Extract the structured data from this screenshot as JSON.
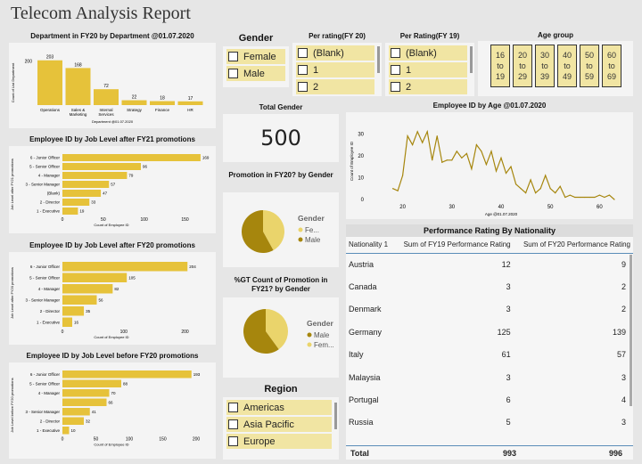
{
  "report_title": "Telecom Analysis Report",
  "colors": {
    "bar": "#e6c23a",
    "dark": "#a6860d",
    "light": "#ead46b",
    "slicer": "#f1e5a3"
  },
  "dept": {
    "title": "Department in FY20 by Department @01.07.2020",
    "ylabel": "Count of List Department",
    "xlabel": "Department @01.07.2020",
    "ytick": "200",
    "bars": [
      {
        "label": "Operations",
        "value": 203
      },
      {
        "label": "Sales & Marketing",
        "value": 168
      },
      {
        "label": "Internal Services",
        "value": 72
      },
      {
        "label": "Strategy",
        "value": 22
      },
      {
        "label": "Finance",
        "value": 18
      },
      {
        "label": "HR",
        "value": 17
      }
    ]
  },
  "job_fy21": {
    "title": "Employee ID by Job Level after FY21 promotions",
    "ylabel": "Job Level after FY21 promotions",
    "xticks": [
      "0",
      "50",
      "100",
      "150"
    ],
    "xlabel": "Count of Employee ID",
    "bars": [
      {
        "label": "6 - Junior Officer",
        "value": 169
      },
      {
        "label": "5 - Senior Officer",
        "value": 96
      },
      {
        "label": "4 - Manager",
        "value": 79
      },
      {
        "label": "3 - Senior Manager",
        "value": 57
      },
      {
        "label": "(Blank)",
        "value": 47
      },
      {
        "label": "2 - Director",
        "value": 33
      },
      {
        "label": "1 - Executive",
        "value": 19
      }
    ]
  },
  "job_fy20": {
    "title": "Employee ID by Job Level after FY20 promotions",
    "ylabel": "Job Level after FY20 promotions",
    "xticks": [
      "0",
      "100",
      "200"
    ],
    "xlabel": "Count of Employee ID",
    "bars": [
      {
        "label": "6 - Junior Officer",
        "value": 204
      },
      {
        "label": "5 - Senior Officer",
        "value": 105
      },
      {
        "label": "4 - Manager",
        "value": 82
      },
      {
        "label": "3 - Senior Manager",
        "value": 56
      },
      {
        "label": "2 - Director",
        "value": 35
      },
      {
        "label": "1 - Executive",
        "value": 16
      }
    ]
  },
  "job_before": {
    "title": "Employee ID by Job Level before FY20 promotions",
    "ylabel": "Job Level before FY20 promotions",
    "xticks": [
      "0",
      "50",
      "100",
      "150",
      "200"
    ],
    "xlabel": "Count of Employee ID",
    "bars": [
      {
        "label": "6 - Junior Officer",
        "value": 193
      },
      {
        "label": "5 - Senior Officer",
        "value": 88
      },
      {
        "label": "4 - Manager",
        "value": 70
      },
      {
        "label": "",
        "value": 66
      },
      {
        "label": "3 - Senior Manager",
        "value": 41
      },
      {
        "label": "2 - Director",
        "value": 32
      },
      {
        "label": "1 - Executive",
        "value": 10
      }
    ]
  },
  "gender_slicer": {
    "title": "Gender",
    "items": [
      "Female",
      "Male"
    ]
  },
  "rating20_slicer": {
    "title": "Per rating(FY 20)",
    "items": [
      "(Blank)",
      "1",
      "2"
    ]
  },
  "rating19_slicer": {
    "title": "Per Rating(FY 19)",
    "items": [
      "(Blank)",
      "1",
      "2"
    ]
  },
  "age_slicer": {
    "title": "Age group",
    "items": [
      [
        "16",
        "to",
        "19"
      ],
      [
        "20",
        "to",
        "29"
      ],
      [
        "30",
        "to",
        "39"
      ],
      [
        "40",
        "to",
        "49"
      ],
      [
        "50",
        "to",
        "59"
      ],
      [
        "60",
        "to",
        "69"
      ]
    ]
  },
  "total_gender": {
    "title": "Total Gender",
    "value": "500"
  },
  "promo_fy20": {
    "title": "Promotion in FY20? by Gender",
    "legend_title": "Gender",
    "legend": [
      "Fe...",
      "Male"
    ],
    "slices": [
      {
        "name": "Fe...",
        "value": 0.42
      },
      {
        "name": "Male",
        "value": 0.58
      }
    ]
  },
  "promo_fy21": {
    "title": "%GT Count of Promotion in FY21? by Gender",
    "legend_title": "Gender",
    "legend": [
      "Male",
      "Fem..."
    ],
    "slices": [
      {
        "name": "Fem...",
        "value": 0.4
      },
      {
        "name": "Male",
        "value": 0.6
      }
    ]
  },
  "region_slicer": {
    "title": "Region",
    "items": [
      "Americas",
      "Asia Pacific",
      "Europe"
    ]
  },
  "age_line": {
    "title": "Employee ID by Age @01.07.2020",
    "ylabel": "Count of Employee ID",
    "xlabel": "Age @01.07.2020",
    "yticks": [
      "0",
      "10",
      "20",
      "30"
    ],
    "xticks": [
      "20",
      "30",
      "40",
      "50",
      "60"
    ]
  },
  "chart_data": {
    "type": "line",
    "x": [
      18,
      19,
      20,
      21,
      22,
      23,
      24,
      25,
      26,
      27,
      28,
      29,
      30,
      31,
      32,
      33,
      34,
      35,
      36,
      37,
      38,
      39,
      40,
      41,
      42,
      43,
      44,
      45,
      46,
      47,
      48,
      49,
      50,
      51,
      52,
      53,
      54,
      55,
      56,
      57,
      58,
      59,
      60,
      61,
      62,
      63
    ],
    "values": [
      5,
      4,
      11,
      29,
      25,
      31,
      26,
      31,
      18,
      29,
      17,
      18,
      18,
      22,
      19,
      21,
      14,
      25,
      22,
      16,
      22,
      13,
      19,
      12,
      15,
      7,
      5,
      3,
      9,
      3,
      5,
      11,
      5,
      3,
      6,
      1,
      2,
      1,
      1,
      1,
      1,
      1,
      2,
      1,
      2,
      0
    ],
    "xlabel": "Age @01.07.2020",
    "ylabel": "Count of Employee ID",
    "ylim": [
      0,
      33
    ]
  },
  "nationality": {
    "title": "Performance Rating By Nationality",
    "headers": [
      "Nationality 1",
      "Sum of FY19 Performance Rating",
      "Sum of FY20 Performance Rating"
    ],
    "rows": [
      [
        "Austria",
        "12",
        "9"
      ],
      [
        "Canada",
        "3",
        "2"
      ],
      [
        "Denmark",
        "3",
        "2"
      ],
      [
        "Germany",
        "125",
        "139"
      ],
      [
        "Italy",
        "61",
        "57"
      ],
      [
        "Malaysia",
        "3",
        "3"
      ],
      [
        "Portugal",
        "6",
        "4"
      ],
      [
        "Russia",
        "5",
        "3"
      ]
    ],
    "total": [
      "Total",
      "993",
      "996"
    ]
  }
}
